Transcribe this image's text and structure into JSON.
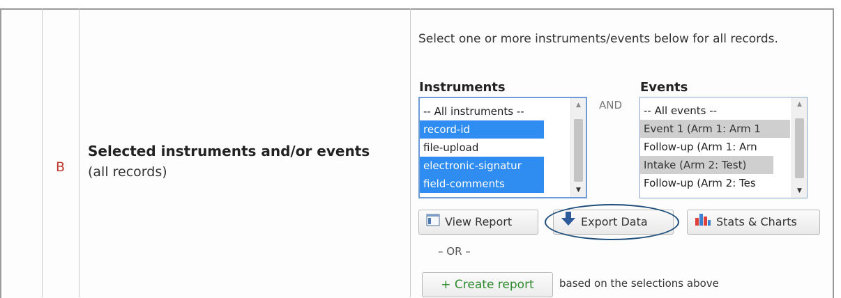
{
  "row": {
    "letter": "B",
    "title": "Selected instruments and/or events",
    "subtitle": "(all records)"
  },
  "description": "Select one or more instruments/events below for all records.",
  "instruments": {
    "heading": "Instruments",
    "items": [
      {
        "label": "-- All instruments --",
        "state": "none"
      },
      {
        "label": "record-id",
        "state": "selected"
      },
      {
        "label": "file-upload",
        "state": "none"
      },
      {
        "label": "electronic-signatur",
        "state": "selected"
      },
      {
        "label": "field-comments",
        "state": "selected"
      }
    ]
  },
  "and_label": "AND",
  "events": {
    "heading": "Events",
    "items": [
      {
        "label": "-- All events --",
        "state": "none"
      },
      {
        "label": "Event 1 (Arm 1: Arm 1",
        "state": "selected"
      },
      {
        "label": "Follow-up (Arm 1: Arn",
        "state": "none"
      },
      {
        "label": "Intake (Arm 2: Test)",
        "state": "selected"
      },
      {
        "label": "Follow-up (Arm 2: Tes",
        "state": "none"
      }
    ]
  },
  "buttons": {
    "view_report": "View Report",
    "export_data": "Export Data",
    "stats_charts": "Stats & Charts"
  },
  "or_label": "– OR –",
  "create_report": {
    "label": "+ Create report",
    "suffix": "based on the selections above"
  },
  "colors": {
    "selected_blue": "#2f8cf0",
    "selected_grey": "#cfcfcf",
    "letter_red": "#c0392b",
    "create_green": "#2e8b2e",
    "highlight_ellipse": "#1f4e7a"
  }
}
